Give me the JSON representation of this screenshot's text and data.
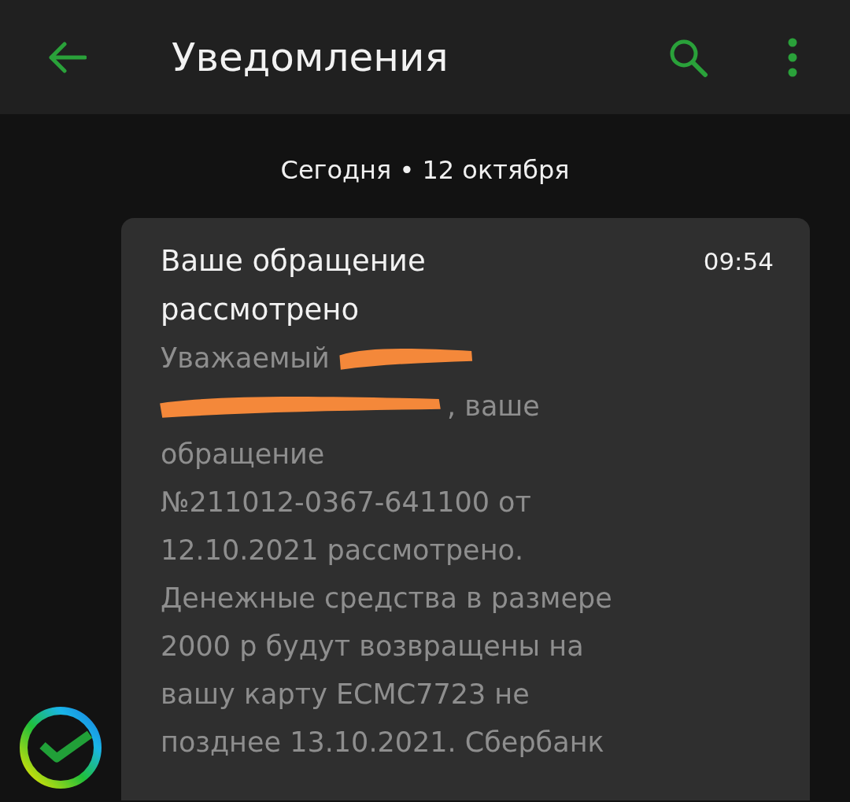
{
  "app_bar": {
    "title": "Уведомления"
  },
  "date_label": "Сегодня • 12 октября",
  "message": {
    "title": "Ваше обращение рассмотрено",
    "time": "09:54",
    "body_lines": [
      [
        {
          "kind": "text",
          "text": "Уважаемый"
        },
        {
          "kind": "redaction"
        }
      ],
      [
        {
          "kind": "redaction"
        },
        {
          "kind": "text",
          "text": ", ваше"
        }
      ],
      [
        {
          "kind": "text",
          "text": "обращение"
        }
      ],
      [
        {
          "kind": "text",
          "text": "№211012-0367-641100 от"
        }
      ],
      [
        {
          "kind": "text",
          "text": "12.10.2021 рассмотрено."
        }
      ],
      [
        {
          "kind": "text",
          "text": "Денежные средства в размере"
        }
      ],
      [
        {
          "kind": "text",
          "text": "2000 р будут возвращены на"
        }
      ],
      [
        {
          "kind": "text",
          "text": "вашу карту ЕСМС7723 не"
        }
      ],
      [
        {
          "kind": "text",
          "text": "позднее 13.10.2021. Сбербанк"
        }
      ]
    ]
  }
}
